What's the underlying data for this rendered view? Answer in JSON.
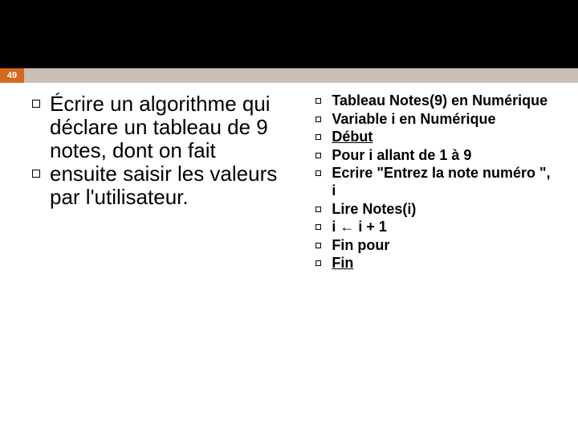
{
  "page_number": "49",
  "left_items": [
    "Écrire un algorithme qui déclare un tableau de 9 notes, dont on fait",
    "ensuite saisir les valeurs par l'utilisateur."
  ],
  "right_items": [
    {
      "text": "Tableau Notes(9) en Numérique",
      "underline": false
    },
    {
      "text": "Variable i en Numérique",
      "underline": false
    },
    {
      "text": "Début",
      "underline": true
    },
    {
      "text": "Pour i allant de 1 à 9",
      "underline": false
    },
    {
      "text": "Ecrire \"Entrez la note numéro \", i",
      "underline": false
    },
    {
      "text": "Lire Notes(i)",
      "underline": false
    },
    {
      "text": "i ← i + 1",
      "underline": false
    },
    {
      "text": "Fin pour",
      "underline": false
    },
    {
      "text": "Fin",
      "underline": true
    }
  ]
}
